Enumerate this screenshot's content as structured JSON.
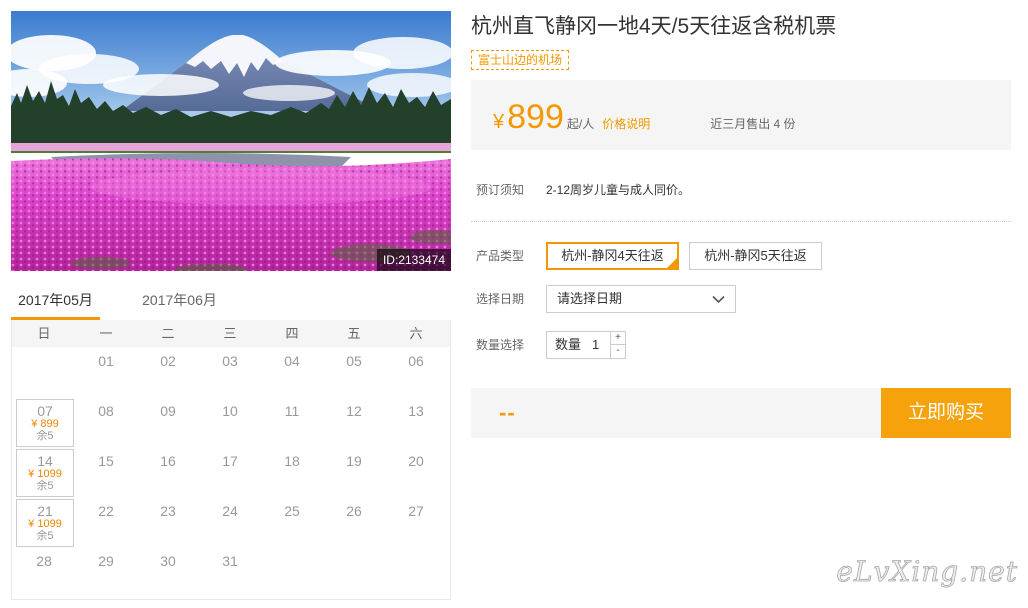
{
  "colors": {
    "accent": "#f39800",
    "buy_button": "#f5a20d",
    "panel_bg": "#f5f5f5"
  },
  "icons": {
    "select": "chevron-down-icon",
    "selected_option": "corner-check-icon",
    "increment": "plus-icon",
    "decrement": "minus-icon"
  },
  "photo": {
    "id_label": "ID:2133474"
  },
  "calendar": {
    "tabs": [
      {
        "label": "2017年05月",
        "active": true
      },
      {
        "label": "2017年06月",
        "active": false
      }
    ],
    "weekdays": [
      "日",
      "一",
      "二",
      "三",
      "四",
      "五",
      "六"
    ],
    "weeks": [
      [
        {
          "day": ""
        },
        {
          "day": "01"
        },
        {
          "day": "02"
        },
        {
          "day": "03"
        },
        {
          "day": "04"
        },
        {
          "day": "05"
        },
        {
          "day": "06"
        }
      ],
      [
        {
          "day": "07",
          "price": "¥ 899",
          "stock": "余5"
        },
        {
          "day": "08"
        },
        {
          "day": "09"
        },
        {
          "day": "10"
        },
        {
          "day": "11"
        },
        {
          "day": "12"
        },
        {
          "day": "13"
        }
      ],
      [
        {
          "day": "14",
          "price": "¥ 1099",
          "stock": "余5"
        },
        {
          "day": "15"
        },
        {
          "day": "16"
        },
        {
          "day": "17"
        },
        {
          "day": "18"
        },
        {
          "day": "19"
        },
        {
          "day": "20"
        }
      ],
      [
        {
          "day": "21",
          "price": "¥ 1099",
          "stock": "余5"
        },
        {
          "day": "22"
        },
        {
          "day": "23"
        },
        {
          "day": "24"
        },
        {
          "day": "25"
        },
        {
          "day": "26"
        },
        {
          "day": "27"
        }
      ],
      [
        {
          "day": "28"
        },
        {
          "day": "29"
        },
        {
          "day": "30"
        },
        {
          "day": "31"
        },
        {
          "day": ""
        },
        {
          "day": ""
        },
        {
          "day": ""
        }
      ]
    ]
  },
  "product": {
    "title": "杭州直飞静冈一地4天/5天往返含税机票",
    "tag": "富士山边的机场"
  },
  "price": {
    "currency": "¥",
    "amount": "899",
    "unit": "起/人",
    "explain_link": "价格说明",
    "sales": "近三月售出 4 份"
  },
  "booking_notice": {
    "label": "预订须知",
    "text": "2-12周岁儿童与成人同价。"
  },
  "product_type": {
    "label": "产品类型",
    "options": [
      {
        "label": "杭州-静冈4天往返",
        "selected": true
      },
      {
        "label": "杭州-静冈5天往返",
        "selected": false
      }
    ]
  },
  "date_select": {
    "label": "选择日期",
    "value": "请选择日期"
  },
  "quantity": {
    "label": "数量选择",
    "prefix": "数量",
    "value": "1",
    "plus": "+",
    "minus": "-"
  },
  "buy": {
    "total": "--",
    "button": "立即购买"
  },
  "watermark": "eLvXing.net"
}
